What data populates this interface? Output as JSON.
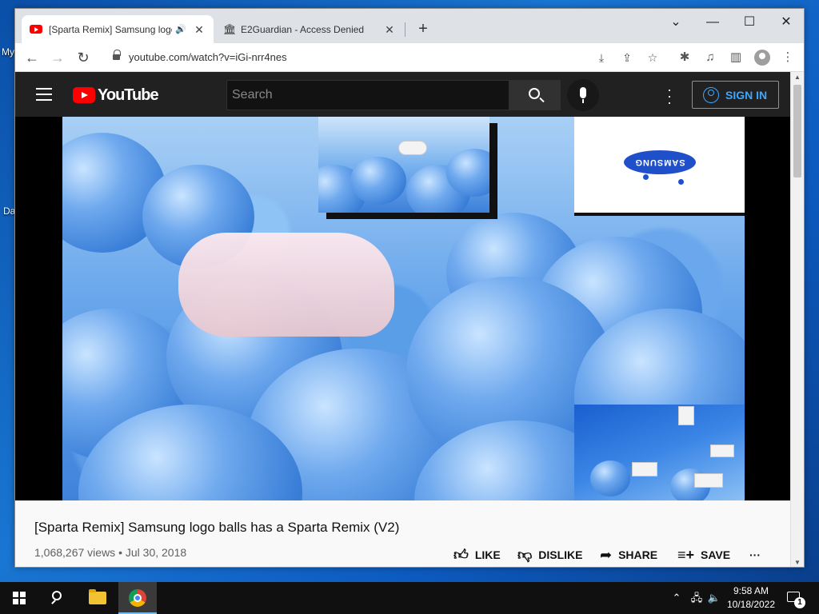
{
  "desktop": {
    "icon_labels": [
      "My",
      "Da"
    ]
  },
  "browser": {
    "tabs": [
      {
        "title": "[Sparta Remix] Samsung logo balls has a Sparta Remix (V2)",
        "active": true,
        "audio": true
      },
      {
        "title": "E2Guardian - Access Denied",
        "active": false
      }
    ],
    "url": "youtube.com/watch?v=iGi-nrr4nes"
  },
  "youtube": {
    "logo_text": "YouTube",
    "search_placeholder": "Search",
    "sign_in_label": "SIGN IN",
    "video": {
      "title": "[Sparta Remix] Samsung logo balls has a Sparta Remix (V2)",
      "views": "1,068,267 views",
      "date": "Jul 30, 2018",
      "pip_logo_text": "SAMSUNG"
    },
    "actions": {
      "like": "LIKE",
      "dislike": "DISLIKE",
      "share": "SHARE",
      "save": "SAVE"
    }
  },
  "taskbar": {
    "time": "9:58 AM",
    "date": "10/18/2022",
    "notification_count": "1",
    "accent_color": "#76b9ed"
  }
}
